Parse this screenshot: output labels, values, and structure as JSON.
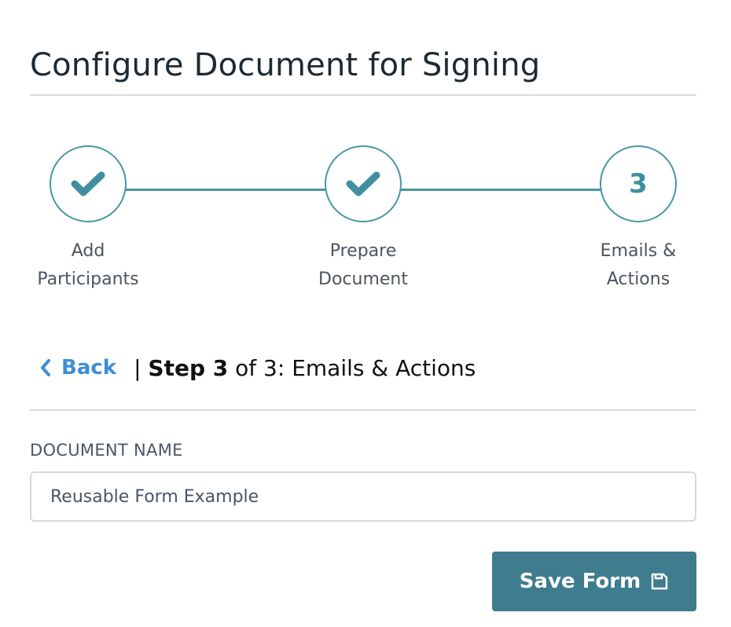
{
  "page": {
    "title": "Configure Document for Signing"
  },
  "stepper": {
    "steps": [
      {
        "label_line1": "Add",
        "label_line2": "Participants",
        "state": "complete",
        "icon": "check-icon"
      },
      {
        "label_line1": "Prepare",
        "label_line2": "Document",
        "state": "complete",
        "icon": "check-icon"
      },
      {
        "label_line1": "Emails &",
        "label_line2": "Actions",
        "state": "current",
        "number": "3"
      }
    ],
    "accent_color": "#4696a6"
  },
  "nav": {
    "back_label": "Back",
    "separator": "|",
    "step_prefix": "Step 3",
    "step_suffix": " of 3: Emails & Actions"
  },
  "form": {
    "document_name_label": "DOCUMENT NAME",
    "document_name_value": "Reusable Form Example"
  },
  "actions": {
    "save_label": "Save Form",
    "save_icon": "floppy-disk-icon",
    "save_color": "#3e7c8e"
  }
}
